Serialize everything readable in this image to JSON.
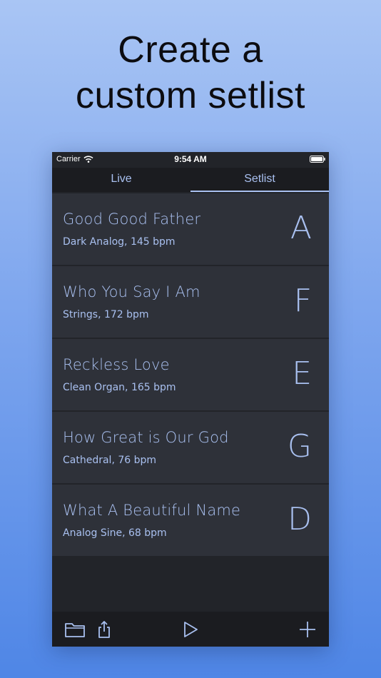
{
  "headline": {
    "line1": "Create a",
    "line2": "custom setlist"
  },
  "status": {
    "carrier": "Carrier",
    "time": "9:54 AM"
  },
  "tabs": [
    {
      "label": "Live",
      "active": false
    },
    {
      "label": "Setlist",
      "active": true
    }
  ],
  "songs": [
    {
      "title": "Good Good Father",
      "subtitle": "Dark Analog, 145 bpm",
      "key": "A"
    },
    {
      "title": "Who You Say I Am",
      "subtitle": "Strings, 172 bpm",
      "key": "F"
    },
    {
      "title": "Reckless Love",
      "subtitle": "Clean Organ, 165 bpm",
      "key": "E"
    },
    {
      "title": "How Great is Our God",
      "subtitle": "Cathedral, 76 bpm",
      "key": "G"
    },
    {
      "title": "What A Beautiful Name",
      "subtitle": "Analog Sine, 68 bpm",
      "key": "D"
    }
  ],
  "toolbar": {
    "icons": [
      "folder-icon",
      "share-icon",
      "play-icon",
      "plus-icon"
    ]
  },
  "colors": {
    "accent": "#a9c0f0",
    "row_bg": "#2e3139",
    "app_bg": "#222429",
    "bar_bg": "#1b1c20"
  }
}
